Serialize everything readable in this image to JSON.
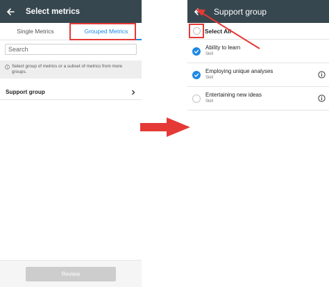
{
  "left_screen": {
    "appbar": {
      "title": "Select metrics"
    },
    "tabs": [
      {
        "label": "Single Metrics",
        "active": false
      },
      {
        "label": "Grouped Metrics",
        "active": true
      }
    ],
    "search": {
      "placeholder": "Search"
    },
    "info": {
      "text": "Select group of metrics or a subset of metrics from more groups."
    },
    "groups": [
      {
        "label": "Support group"
      }
    ],
    "review_button": {
      "label": "Review",
      "enabled": false
    }
  },
  "right_screen": {
    "appbar": {
      "title": "Support group"
    },
    "select_all": {
      "label": "Select All",
      "checked": false
    },
    "metrics": [
      {
        "name": "Ability to learn",
        "type": "Skill",
        "checked": true,
        "has_info": false
      },
      {
        "name": "Employing unique analyses",
        "type": "Skill",
        "checked": true,
        "has_info": true
      },
      {
        "name": "Entertaining new ideas",
        "type": "Skill",
        "checked": false,
        "has_info": true
      }
    ]
  },
  "colors": {
    "appbar": "#37474f",
    "accent": "#1e88e5",
    "annotation": "#e53935",
    "button_disabled": "#cdcdcd"
  }
}
